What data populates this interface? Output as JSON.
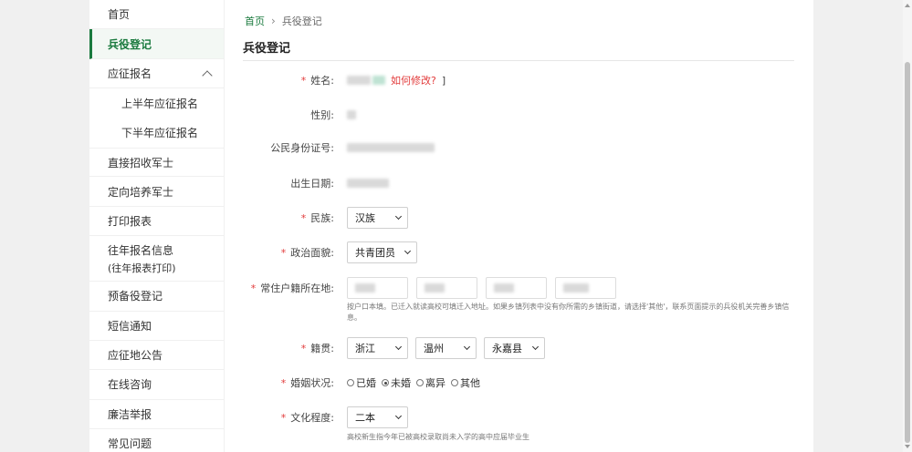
{
  "sidebar": {
    "items": [
      {
        "label": "首页"
      },
      {
        "label": "兵役登记"
      },
      {
        "label": "应征报名"
      },
      {
        "label": "上半年应征报名"
      },
      {
        "label": "下半年应征报名"
      },
      {
        "label": "直接招收军士"
      },
      {
        "label": "定向培养军士"
      },
      {
        "label": "打印报表"
      },
      {
        "label": "往年报名信息",
        "label2": "(往年报表打印)"
      },
      {
        "label": "预备役登记"
      },
      {
        "label": "短信通知"
      },
      {
        "label": "应征地公告"
      },
      {
        "label": "在线咨询"
      },
      {
        "label": "廉洁举报"
      },
      {
        "label": "常见问题"
      }
    ],
    "active_index": 1
  },
  "breadcrumb": {
    "home": "首页",
    "current": "兵役登记"
  },
  "page_title": "兵役登记",
  "form": {
    "name": {
      "label": "姓名:",
      "value": "",
      "link": "如何修改?",
      "bracket": "]"
    },
    "gender": {
      "label": "性别:",
      "value": ""
    },
    "id_number": {
      "label": "公民身份证号:",
      "value": ""
    },
    "birth_date": {
      "label": "出生日期:",
      "value": ""
    },
    "ethnicity": {
      "label": "民族:",
      "value": "汉族"
    },
    "political": {
      "label": "政治面貌:",
      "value": "共青团员"
    },
    "residence": {
      "label": "常住户籍所在地:",
      "hint": "按户口本填。已迁入就读高校可填迁入地址。如果乡镇列表中没有你所需的乡镇街道，请选择'其他'，联系页面提示的兵役机关完善乡镇信息。"
    },
    "native_place": {
      "label": "籍贯:",
      "province": "浙江",
      "city": "温州",
      "county": "永嘉县"
    },
    "marital": {
      "label": "婚姻状况:",
      "options": [
        "已婚",
        "未婚",
        "离异",
        "其他"
      ],
      "selected": "未婚"
    },
    "education": {
      "label": "文化程度:",
      "value": "二本",
      "hint": "高校新生指今年已被高校录取尚未入学的高中应届毕业生"
    }
  }
}
